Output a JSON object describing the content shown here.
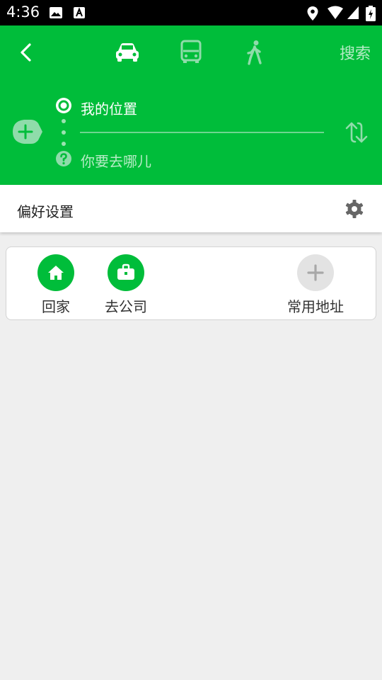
{
  "status_bar": {
    "time": "4:36",
    "icons": [
      "image-icon",
      "text-icon",
      "location-pin-icon",
      "wifi-icon",
      "signal-icon",
      "battery-icon"
    ]
  },
  "header": {
    "search_label": "搜索",
    "modes": [
      "car-icon",
      "bus-icon",
      "walk-icon"
    ],
    "origin": "我的位置",
    "destination_placeholder": "你要去哪儿"
  },
  "preferences": {
    "label": "偏好设置"
  },
  "shortcuts": [
    {
      "label": "回家",
      "icon": "home-icon"
    },
    {
      "label": "去公司",
      "icon": "briefcase-icon"
    },
    {
      "label": "常用地址",
      "icon": "plus-icon"
    }
  ],
  "colors": {
    "brand_green": "#00bd3a",
    "muted_text": "#b6ecc6",
    "background": "#efefef"
  }
}
